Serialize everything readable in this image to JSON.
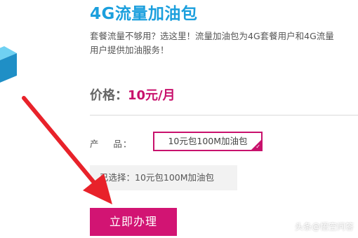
{
  "package": {
    "title": "4G流量加油包",
    "description": "套餐流量不够用？选这里！流量加油包为4G套餐用户和4G流量\n用户提供加油服务！"
  },
  "price": {
    "label": "价格：",
    "value": "10元/月"
  },
  "product": {
    "label": "产    品：",
    "option": "10元包100M加油包"
  },
  "selection": {
    "text": "已选择：10元包100M加油包"
  },
  "actions": {
    "submit_label": "立即办理"
  },
  "watermark": {
    "text": "头条@悟空问答"
  },
  "colors": {
    "title": "#1b9fdd",
    "accent": "#c8116c",
    "button": "#d21473",
    "annotation_arrow": "#e8222a"
  },
  "icons": {
    "left_graphic": "cube-graphic",
    "option_selected": "checkmark-icon",
    "annotation": "red-arrow-annotation"
  }
}
